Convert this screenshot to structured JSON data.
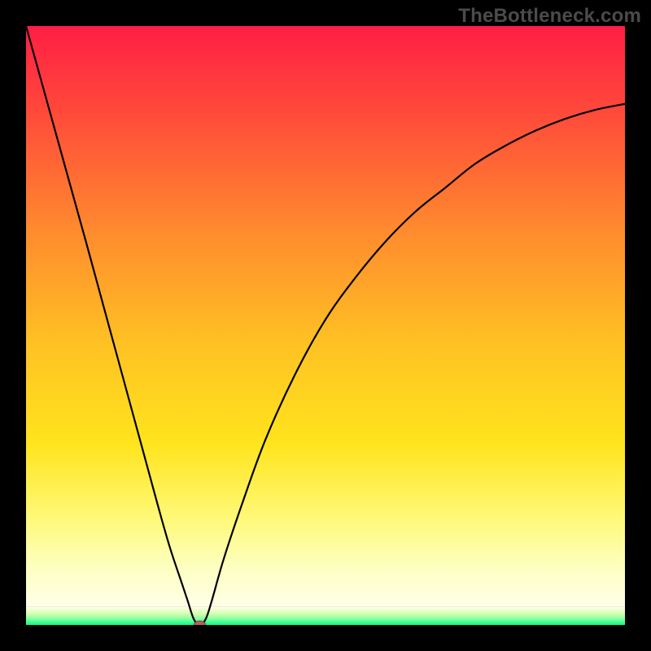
{
  "watermark": "TheBottleneck.com",
  "colors": {
    "curve": "#000000",
    "dot_fill": "#b56060",
    "dot_stroke": "#8a3f3f",
    "gradient_stops_main": [
      {
        "offset": 0.0,
        "color": "#ff1e45"
      },
      {
        "offset": 0.15,
        "color": "#ff4a3a"
      },
      {
        "offset": 0.35,
        "color": "#ff8a2e"
      },
      {
        "offset": 0.55,
        "color": "#ffc223"
      },
      {
        "offset": 0.72,
        "color": "#ffe41d"
      },
      {
        "offset": 0.85,
        "color": "#fff97a"
      },
      {
        "offset": 0.93,
        "color": "#fdffbf"
      },
      {
        "offset": 1.0,
        "color": "#ffffe8"
      }
    ],
    "gradient_stops_band": [
      {
        "offset": 0.0,
        "color": "#ffffe8"
      },
      {
        "offset": 0.35,
        "color": "#d9ffb0"
      },
      {
        "offset": 0.7,
        "color": "#7cff9e"
      },
      {
        "offset": 1.0,
        "color": "#00ff87"
      }
    ]
  },
  "chart_data": {
    "type": "line",
    "title": "",
    "xlabel": "",
    "ylabel": "",
    "xlim": [
      0,
      100
    ],
    "ylim": [
      0,
      100
    ],
    "grid": false,
    "legend": false,
    "annotations": [],
    "minimum_marker": {
      "x": 29,
      "y": 0,
      "shown": true
    },
    "series": [
      {
        "name": "curve",
        "x": [
          0,
          5,
          10,
          13,
          16,
          19,
          22,
          24,
          26,
          27,
          28,
          29,
          30,
          31,
          33,
          36,
          40,
          45,
          50,
          55,
          60,
          65,
          70,
          75,
          80,
          85,
          90,
          95,
          100
        ],
        "values": [
          100,
          82,
          64,
          53,
          42,
          31,
          20,
          13,
          7,
          4,
          1,
          0,
          1,
          4,
          11,
          20,
          31,
          42,
          51,
          58,
          64,
          69,
          73,
          77,
          80,
          82.5,
          84.5,
          86,
          87
        ]
      }
    ],
    "bottom_band_height_pct": 3.0
  }
}
